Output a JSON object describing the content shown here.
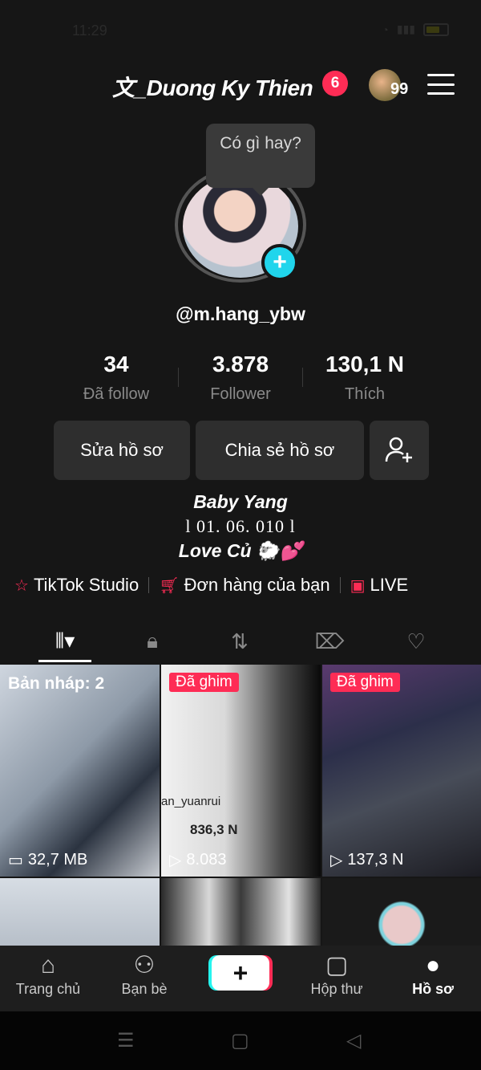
{
  "status_bar": {
    "time": "11:29"
  },
  "header": {
    "username": "文_Duong Ky Thien",
    "notification_count": "6",
    "avatar_count": "99"
  },
  "tooltip": {
    "text": "Có gì hay?"
  },
  "profile": {
    "handle": "@m.hang_ybw",
    "stats": [
      {
        "value": "34",
        "label": "Đã follow"
      },
      {
        "value": "3.878",
        "label": "Follower"
      },
      {
        "value": "130,1 N",
        "label": "Thích"
      }
    ],
    "buttons": {
      "edit": "Sửa hồ sơ",
      "share": "Chia sẻ hồ sơ"
    },
    "bio": {
      "line1": "Baby Yang",
      "line2": "l 01. 06. 010 l",
      "line3": "Love Củ 🐑💕"
    }
  },
  "links": {
    "studio": "TikTok Studio",
    "orders": "Đơn hàng của bạn",
    "live": "LIVE"
  },
  "grid": [
    {
      "overlay": "Bản nháp: 2",
      "meta": "32,7 MB",
      "meta_icon": "folder-icon"
    },
    {
      "badge": "Đã ghim",
      "meta": "8.083",
      "meta_icon": "play-icon",
      "caption": "an_yuanrui",
      "caption_count": "836,3 N"
    },
    {
      "badge": "Đã ghim",
      "meta": "137,3 N",
      "meta_icon": "play-icon"
    },
    {
      "meta": ""
    },
    {
      "meta": ""
    },
    {
      "meta": ""
    }
  ],
  "bottom_nav": [
    {
      "label": "Trang chủ",
      "icon": "home-icon"
    },
    {
      "label": "Bạn bè",
      "icon": "friends-icon"
    },
    {
      "label": "",
      "icon": "create-icon"
    },
    {
      "label": "Hộp thư",
      "icon": "inbox-icon"
    },
    {
      "label": "Hồ sơ",
      "icon": "profile-icon"
    }
  ],
  "colors": {
    "accent": "#fe2c55",
    "cyan": "#25f4ee",
    "background": "#161616"
  }
}
